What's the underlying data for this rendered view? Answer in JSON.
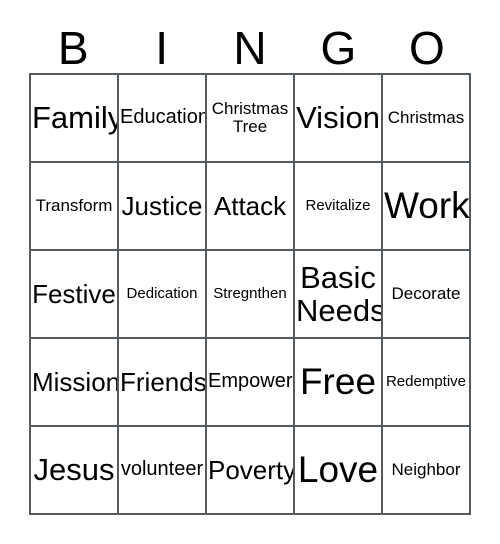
{
  "card": {
    "headers": [
      "B",
      "I",
      "N",
      "G",
      "O"
    ],
    "free_space_label": "Free",
    "cells": [
      {
        "text": "Family",
        "size": "lg"
      },
      {
        "text": "Education",
        "size": "sm"
      },
      {
        "text": "Christmas\nTree",
        "size": "xs"
      },
      {
        "text": "Vision",
        "size": "lg"
      },
      {
        "text": "Christmas",
        "size": "xs"
      },
      {
        "text": "Transform",
        "size": "xs"
      },
      {
        "text": "Justice",
        "size": "md"
      },
      {
        "text": "Attack",
        "size": "md"
      },
      {
        "text": "Revitalize",
        "size": "xxs"
      },
      {
        "text": "Work",
        "size": "xl"
      },
      {
        "text": "Festive",
        "size": "md"
      },
      {
        "text": "Dedication",
        "size": "xxs"
      },
      {
        "text": "Stregnthen",
        "size": "xxs"
      },
      {
        "text": "Basic\nNeeds",
        "size": "lg"
      },
      {
        "text": "Decorate",
        "size": "xs"
      },
      {
        "text": "Mission",
        "size": "md"
      },
      {
        "text": "Friends",
        "size": "md"
      },
      {
        "text": "Empower",
        "size": "sm"
      },
      {
        "text": "Free",
        "size": "xl"
      },
      {
        "text": "Redemptive",
        "size": "xxs"
      },
      {
        "text": "Jesus",
        "size": "lg"
      },
      {
        "text": "volunteer",
        "size": "sm"
      },
      {
        "text": "Poverty",
        "size": "md"
      },
      {
        "text": "Love",
        "size": "xl"
      },
      {
        "text": "Neighbor",
        "size": "xs"
      }
    ]
  },
  "colors": {
    "background": "#ffffff",
    "text": "#000000",
    "grid_line": "#555a5e"
  }
}
